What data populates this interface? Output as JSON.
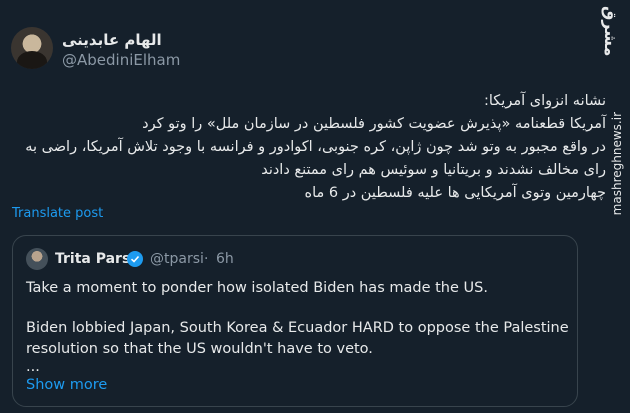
{
  "author": {
    "name": "الهام عابدینی",
    "handle": "@AbediniElham"
  },
  "watermark": {
    "logo": "مشرق",
    "site": "mashreghnews.ir"
  },
  "tweet": {
    "lines": [
      "نشانه انزوای آمریکا:",
      "آمریکا قطعنامه «پذیرش عضویت کشور فلسطین در سازمان ملل» را وتو کرد",
      "در واقع مجبور به وتو شد چون ژاپن، کره جنوبی، اکوادور و فرانسه با وجود تلاش آمریکا، راضی به",
      "رای مخالف نشدند و بریتانیا و سوئیس هم رای ممتنع دادند",
      "چهارمین وتوی آمریکایی ها علیه فلسطین در 6 ماه"
    ],
    "translate_label": "Translate post"
  },
  "quote": {
    "name": "Trita Parsi",
    "handle": "@tparsi",
    "separator": "·",
    "time": "6h",
    "line1": "Take a moment to ponder how isolated Biden has made the US.",
    "line2": "Biden lobbied Japan, South Korea & Ecuador HARD to oppose the Palestine",
    "line3": "resolution so that the US wouldn't have to veto.",
    "line4": "...",
    "show_more": "Show more"
  },
  "colors": {
    "background": "#15202b",
    "text": "#e7e9ea",
    "muted": "#8b98a5",
    "accent": "#1d9bf0",
    "border": "#38444d"
  }
}
